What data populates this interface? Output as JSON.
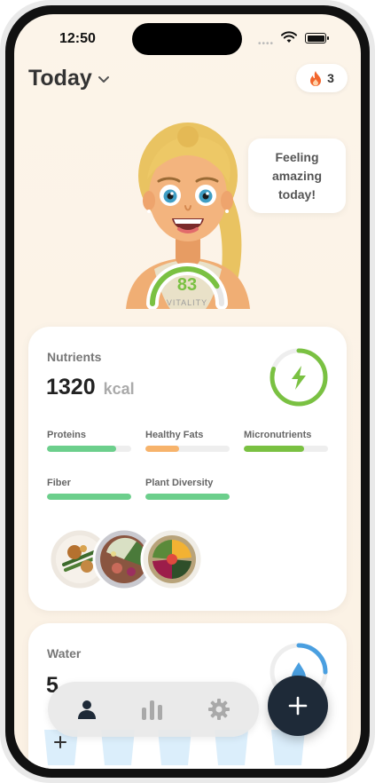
{
  "status_bar": {
    "time": "12:50",
    "signal_icon": "signal-dots-icon",
    "wifi_icon": "wifi-icon",
    "battery_icon": "battery-icon"
  },
  "header": {
    "title": "Today",
    "dropdown_icon": "chevron-down-icon",
    "streak_count": "3",
    "streak_icon": "flame-icon"
  },
  "avatar": {
    "speech": "Feeling amazing today!",
    "vitality_value": "83",
    "vitality_label": "VITALITY",
    "vitality_fraction": 0.83,
    "accent": "#7ac142"
  },
  "nutrients_card": {
    "title": "Nutrients",
    "kcal_value": "1320",
    "kcal_unit": "kcal",
    "energy_icon": "lightning-bolt-icon",
    "energy_fraction": 0.8,
    "metrics": [
      {
        "label": "Proteins",
        "fraction": 0.82,
        "color": "#6ccf8c"
      },
      {
        "label": "Healthy Fats",
        "fraction": 0.4,
        "color": "#f7b36b"
      },
      {
        "label": "Micronutrients",
        "fraction": 0.72,
        "color": "#7ac142"
      },
      {
        "label": "Fiber",
        "fraction": 1.0,
        "color": "#6ccf8c"
      },
      {
        "label": "Plant Diversity",
        "fraction": 1.0,
        "color": "#6ccf8c"
      }
    ],
    "meal_photos": [
      "meal-plate-greens-icon",
      "meal-bowl-beef-icon",
      "meal-bowl-beets-icon"
    ]
  },
  "water_card": {
    "title": "Water",
    "value": "5",
    "add_icon": "plus-icon",
    "drop_icon": "water-drop-icon",
    "ring_fraction": 0.25,
    "accent": "#4a9fe0"
  },
  "tabbar": {
    "tabs": [
      {
        "icon": "person-icon"
      },
      {
        "icon": "bar-chart-icon"
      },
      {
        "icon": "gear-icon"
      }
    ],
    "fab_icon": "plus-icon"
  }
}
